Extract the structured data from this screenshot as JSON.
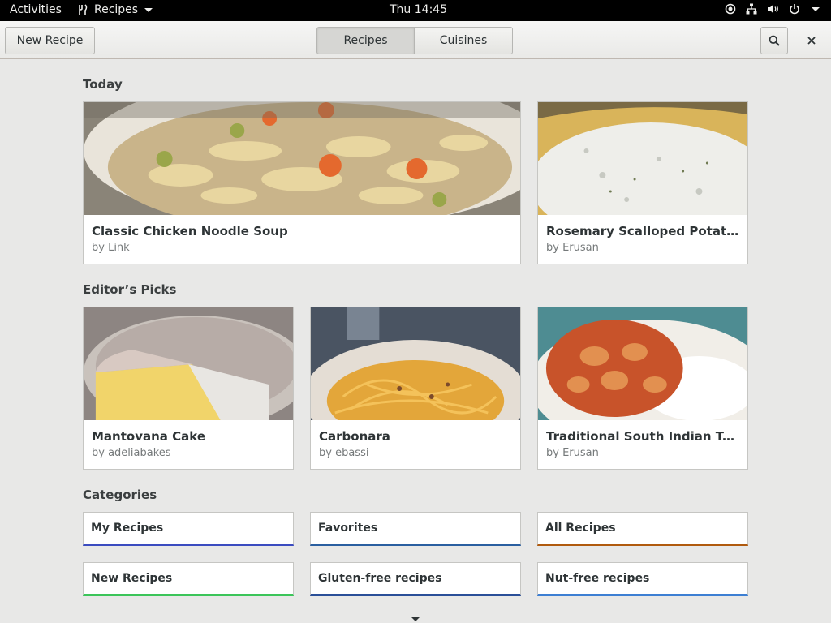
{
  "topbar": {
    "activities": "Activities",
    "app_name": "Recipes",
    "clock": "Thu 14:45",
    "icons": [
      "location-icon",
      "network-icon",
      "volume-icon",
      "power-icon"
    ]
  },
  "header": {
    "new_recipe": "New Recipe",
    "tabs": [
      {
        "label": "Recipes"
      },
      {
        "label": "Cuisines"
      }
    ],
    "active_tab": "Recipes"
  },
  "sections": {
    "today": "Today",
    "editors_picks": "Editor’s Picks",
    "categories": "Categories"
  },
  "today": [
    {
      "title": "Classic Chicken Noodle Soup",
      "author": "by Link",
      "image": "chicken-noodle-soup-photo"
    },
    {
      "title": "Rosemary Scalloped Potatoes",
      "author": "by Erusan",
      "image": "scalloped-potatoes-photo"
    }
  ],
  "picks": [
    {
      "title": "Mantovana Cake",
      "author": "by adeliabakes",
      "image": "cake-photo"
    },
    {
      "title": "Carbonara",
      "author": "by ebassi",
      "image": "carbonara-photo"
    },
    {
      "title": "Traditional South Indian Tomat…",
      "author": "by Erusan",
      "image": "curry-rice-photo"
    }
  ],
  "categories": [
    {
      "label": "My Recipes",
      "color": "#3b4cc0"
    },
    {
      "label": "Favorites",
      "color": "#2a5fa0"
    },
    {
      "label": "All Recipes",
      "color": "#b05a0e"
    },
    {
      "label": "New Recipes",
      "color": "#3cc55a"
    },
    {
      "label": "Gluten-free recipes",
      "color": "#2a4f98"
    },
    {
      "label": "Nut-free recipes",
      "color": "#3d7fd3"
    }
  ]
}
